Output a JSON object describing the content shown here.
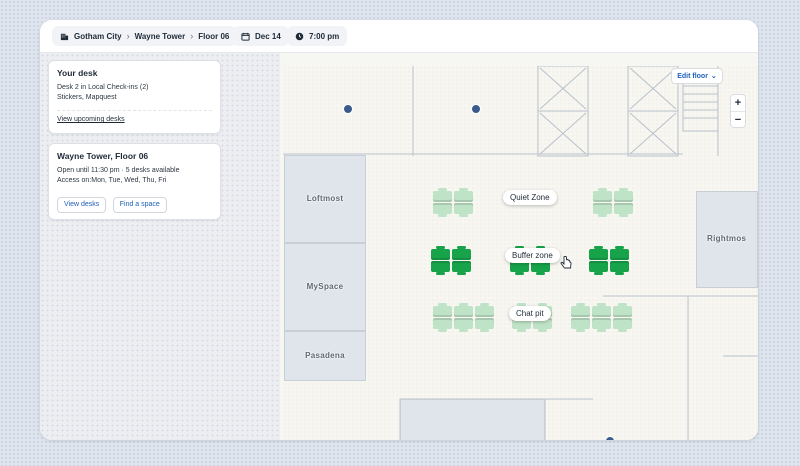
{
  "breadcrumb": {
    "city": "Gotham City",
    "building": "Wayne Tower",
    "floor": "Floor 06"
  },
  "date": "Dec 14",
  "time": "7:00 pm",
  "your_desk": {
    "title": "Your desk",
    "line1": "Desk 2 in Local Check-ins (2)",
    "line2": "Stickers, Mapquest",
    "link": "View upcoming desks"
  },
  "floor_card": {
    "title": "Wayne Tower, Floor 06",
    "hours": "Open until 11:30 pm",
    "desks_available": "5 desks available",
    "access": "Access on:Mon, Tue, Wed, Thu, Fri",
    "view_desks": "View desks",
    "find_space": "Find a space"
  },
  "map": {
    "edit_floor": "Edit floor",
    "zoom_in": "+",
    "zoom_out": "−",
    "rooms": {
      "loftmost": "Loftmost",
      "myspace": "MySpace",
      "pasadena": "Pasadena",
      "rightmost": "Rightmos"
    },
    "zones": {
      "quiet": "Quiet Zone",
      "buffer": "Buffer zone",
      "chat": "Chat pit"
    }
  },
  "colors": {
    "desk_available": "#17a34a",
    "desk_light": "#bfe3c6",
    "accent": "#1e5fb8"
  }
}
